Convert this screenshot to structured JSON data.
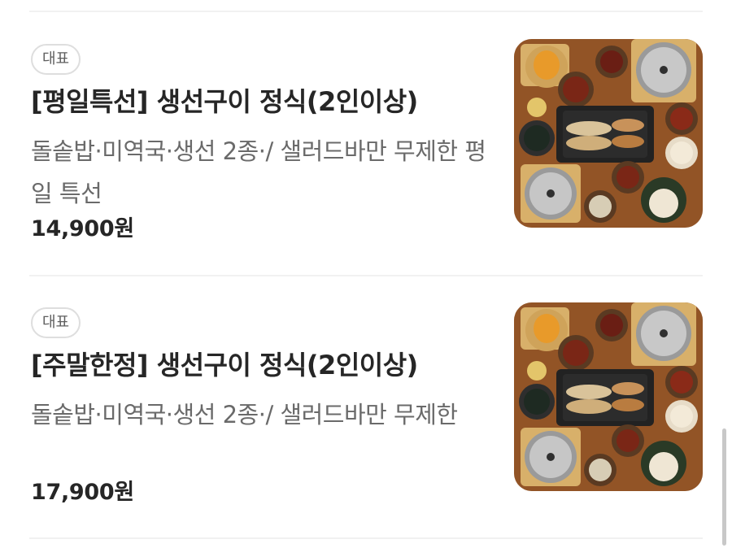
{
  "items": [
    {
      "badge": "대표",
      "title": "[평일특선] 생선구이 정식(2인이상)",
      "description": "돌솥밥·미역국·생선 2종·/ 샐러드바만 무제한 평일 특선",
      "price": "14,900원",
      "image_alt": "생선구이 정식 상차림 사진"
    },
    {
      "badge": "대표",
      "title": "[주말한정] 생선구이 정식(2인이상)",
      "description": "돌솥밥·미역국·생선 2종·/ 샐러드바만 무제한",
      "price": "17,900원",
      "image_alt": "생선구이 정식 상차림 사진"
    }
  ],
  "colors": {
    "background": "#ffffff",
    "title_text": "#262626",
    "description_text": "#6a6a6a",
    "badge_border": "#dedede",
    "divider": "#f1f1f1",
    "wood_tray": "#8a4e22"
  }
}
